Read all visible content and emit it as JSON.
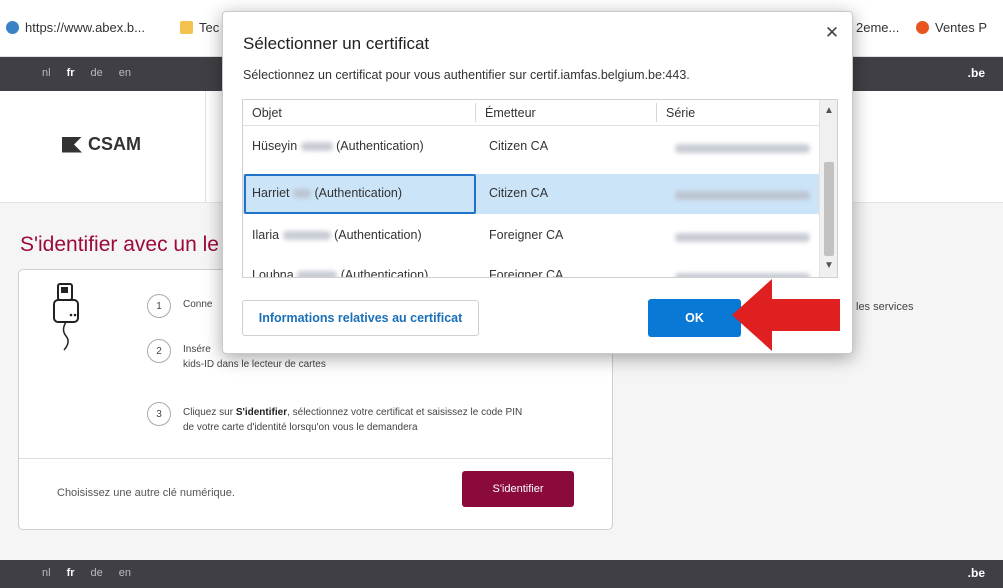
{
  "bookmarks": [
    {
      "label": "https://www.abex.b...",
      "color": "#3b82c4"
    },
    {
      "label": "Tec",
      "color": "#f2c14e"
    },
    {
      "label": "2eme...",
      "color": "#ffffff"
    },
    {
      "label": "Ventes P",
      "color": "#e8541e"
    }
  ],
  "langbar": {
    "items": [
      "nl",
      "fr",
      "de",
      "en"
    ],
    "active": "fr",
    "site_label": ".be"
  },
  "header": {
    "logo_text": "CSAM",
    "logo_icon": "csam-logo-icon"
  },
  "main": {
    "heading": "S'identifier avec un le",
    "steps": [
      {
        "num": "1",
        "text": "Conne"
      },
      {
        "num": "2",
        "text_line1": "Insére",
        "text_line2": "kids-ID dans le lecteur de cartes"
      },
      {
        "num": "3",
        "text_bold": "S'identifier",
        "text_pre": "Cliquez sur ",
        "text_post": ", sélectionnez votre certificat et saisissez le code PIN",
        "text_line2": "de votre carte d'identité lorsqu'on vous le demandera"
      }
    ],
    "other_key_link": "Choisissez une autre clé numérique.",
    "signin_button": "S'identifier",
    "side_text": "les services"
  },
  "dialog": {
    "title": "Sélectionner un certificat",
    "description": "Sélectionnez un certificat pour vous authentifier sur certif.iamfas.belgium.be:443.",
    "close_icon": "close-icon",
    "columns": [
      "Objet",
      "Émetteur",
      "Série"
    ],
    "rows": [
      {
        "name_first": "Hüseyin",
        "name_suffix": "(Authentication)",
        "issuer": "Citizen CA",
        "selected": false
      },
      {
        "name_first": "Harriet",
        "name_suffix": "(Authentication)",
        "issuer": "Citizen CA",
        "selected": true
      },
      {
        "name_first": "Ilaria",
        "name_suffix": "(Authentication)",
        "issuer": "Foreigner CA",
        "selected": false
      },
      {
        "name_first": "Loubna",
        "name_suffix": "(Authentication)",
        "issuer": "Foreigner CA",
        "selected": false
      }
    ],
    "info_button": "Informations relatives au certificat",
    "ok_button": "OK"
  },
  "annotation": {
    "arrow_color": "#e02020",
    "arrow_icon": "red-arrow-icon"
  }
}
